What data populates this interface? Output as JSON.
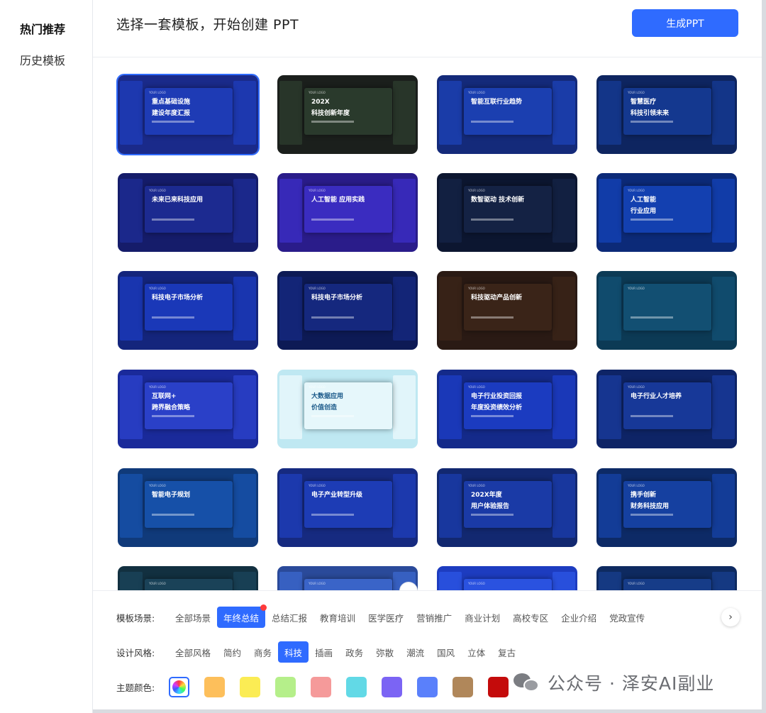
{
  "sidebar": {
    "items": [
      {
        "label": "热门推荐"
      },
      {
        "label": "历史模板"
      }
    ]
  },
  "header": {
    "title": "选择一套模板，开始创建 PPT",
    "generate_label": "生成PPT"
  },
  "templates": [
    {
      "title": [
        "重点基础设施",
        "建设年度汇报"
      ],
      "bg": "#1a2a8a",
      "slide": "#1e3bb5"
    },
    {
      "title": [
        "202X",
        "科技创新年度"
      ],
      "bg": "#1b1f1c",
      "slide": "#2a3a2c"
    },
    {
      "title": [
        "智能互联行业趋势",
        ""
      ],
      "bg": "#142a7a",
      "slide": "#1b3fb0"
    },
    {
      "title": [
        "智慧医疗",
        "科技引领未来"
      ],
      "bg": "#0e2560",
      "slide": "#14388f"
    },
    {
      "title": [
        "未来已来科技应用",
        ""
      ],
      "bg": "#151c6a",
      "slide": "#1c2a90"
    },
    {
      "title": [
        "人工智能 应用实践",
        ""
      ],
      "bg": "#2a1c8a",
      "slide": "#3a2cc0"
    },
    {
      "title": [
        "数智驱动 技术创新",
        ""
      ],
      "bg": "#0c1630",
      "slide": "#142244"
    },
    {
      "title": [
        "人工智能",
        "行业应用"
      ],
      "bg": "#0c2a78",
      "slide": "#1340b0"
    },
    {
      "title": [
        "科技电子市场分析",
        ""
      ],
      "bg": "#14257c",
      "slide": "#1a38b8"
    },
    {
      "title": [
        "科技电子市场分析",
        ""
      ],
      "bg": "#0d1a55",
      "slide": "#15287e"
    },
    {
      "title": [
        "科技驱动产品创新",
        ""
      ],
      "bg": "#2a1a14",
      "slide": "#3a2418"
    },
    {
      "title": [
        "",
        ""
      ],
      "bg": "#0c3a55",
      "slide": "#124f72"
    },
    {
      "title": [
        "互联网+",
        "跨界融合策略"
      ],
      "bg": "#1a2a9a",
      "slide": "#2a40c8"
    },
    {
      "title": [
        "大数据应用",
        "价值创造"
      ],
      "bg": "#bfe8f2",
      "slide": "#e6f7fb"
    },
    {
      "title": [
        "电子行业投资回报",
        "年度投资绩效分析"
      ],
      "bg": "#142a8a",
      "slide": "#1b3bc0"
    },
    {
      "title": [
        "电子行业人才培养",
        ""
      ],
      "bg": "#0e2466",
      "slide": "#173898"
    },
    {
      "title": [
        "智能电子规划",
        ""
      ],
      "bg": "#103a7a",
      "slide": "#1650a8"
    },
    {
      "title": [
        "电子产业转型升级",
        ""
      ],
      "bg": "#162a80",
      "slide": "#1d3cb5"
    },
    {
      "title": [
        "202X年度",
        "用户体验报告"
      ],
      "bg": "#122870",
      "slide": "#1a3aa6"
    },
    {
      "title": [
        "携手创新",
        "财务科技应用"
      ],
      "bg": "#0d2a66",
      "slide": "#1540a0"
    },
    {
      "title": [
        "",
        ""
      ],
      "bg": "#123040",
      "slide": "#1a4258"
    },
    {
      "title": [
        "",
        ""
      ],
      "bg": "#2a4a9a",
      "slide": "#3a64c8"
    },
    {
      "title": [
        "",
        ""
      ],
      "bg": "#1d3cc0",
      "slide": "#2a52e0"
    },
    {
      "title": [
        "",
        ""
      ],
      "bg": "#0e2a60",
      "slide": "#163c88"
    }
  ],
  "filters": {
    "scene": {
      "label": "模板场景:",
      "options": [
        "全部场景",
        "年终总结",
        "总结汇报",
        "教育培训",
        "医学医疗",
        "营销推广",
        "商业计划",
        "高校专区",
        "企业介绍",
        "党政宣传"
      ],
      "active": "年终总结"
    },
    "style": {
      "label": "设计风格:",
      "options": [
        "全部风格",
        "简约",
        "商务",
        "科技",
        "插画",
        "政务",
        "弥散",
        "潮流",
        "国风",
        "立体",
        "复古"
      ],
      "active": "科技"
    },
    "color": {
      "label": "主题颜色:",
      "swatches": [
        "#fdbf5b",
        "#fbec54",
        "#b5ef8a",
        "#f59a9a",
        "#62d9e6",
        "#7b64f4",
        "#5a80fb",
        "#b0875a",
        "#c40b0b"
      ]
    }
  },
  "watermark": "公众号 · 泽安AI副业"
}
